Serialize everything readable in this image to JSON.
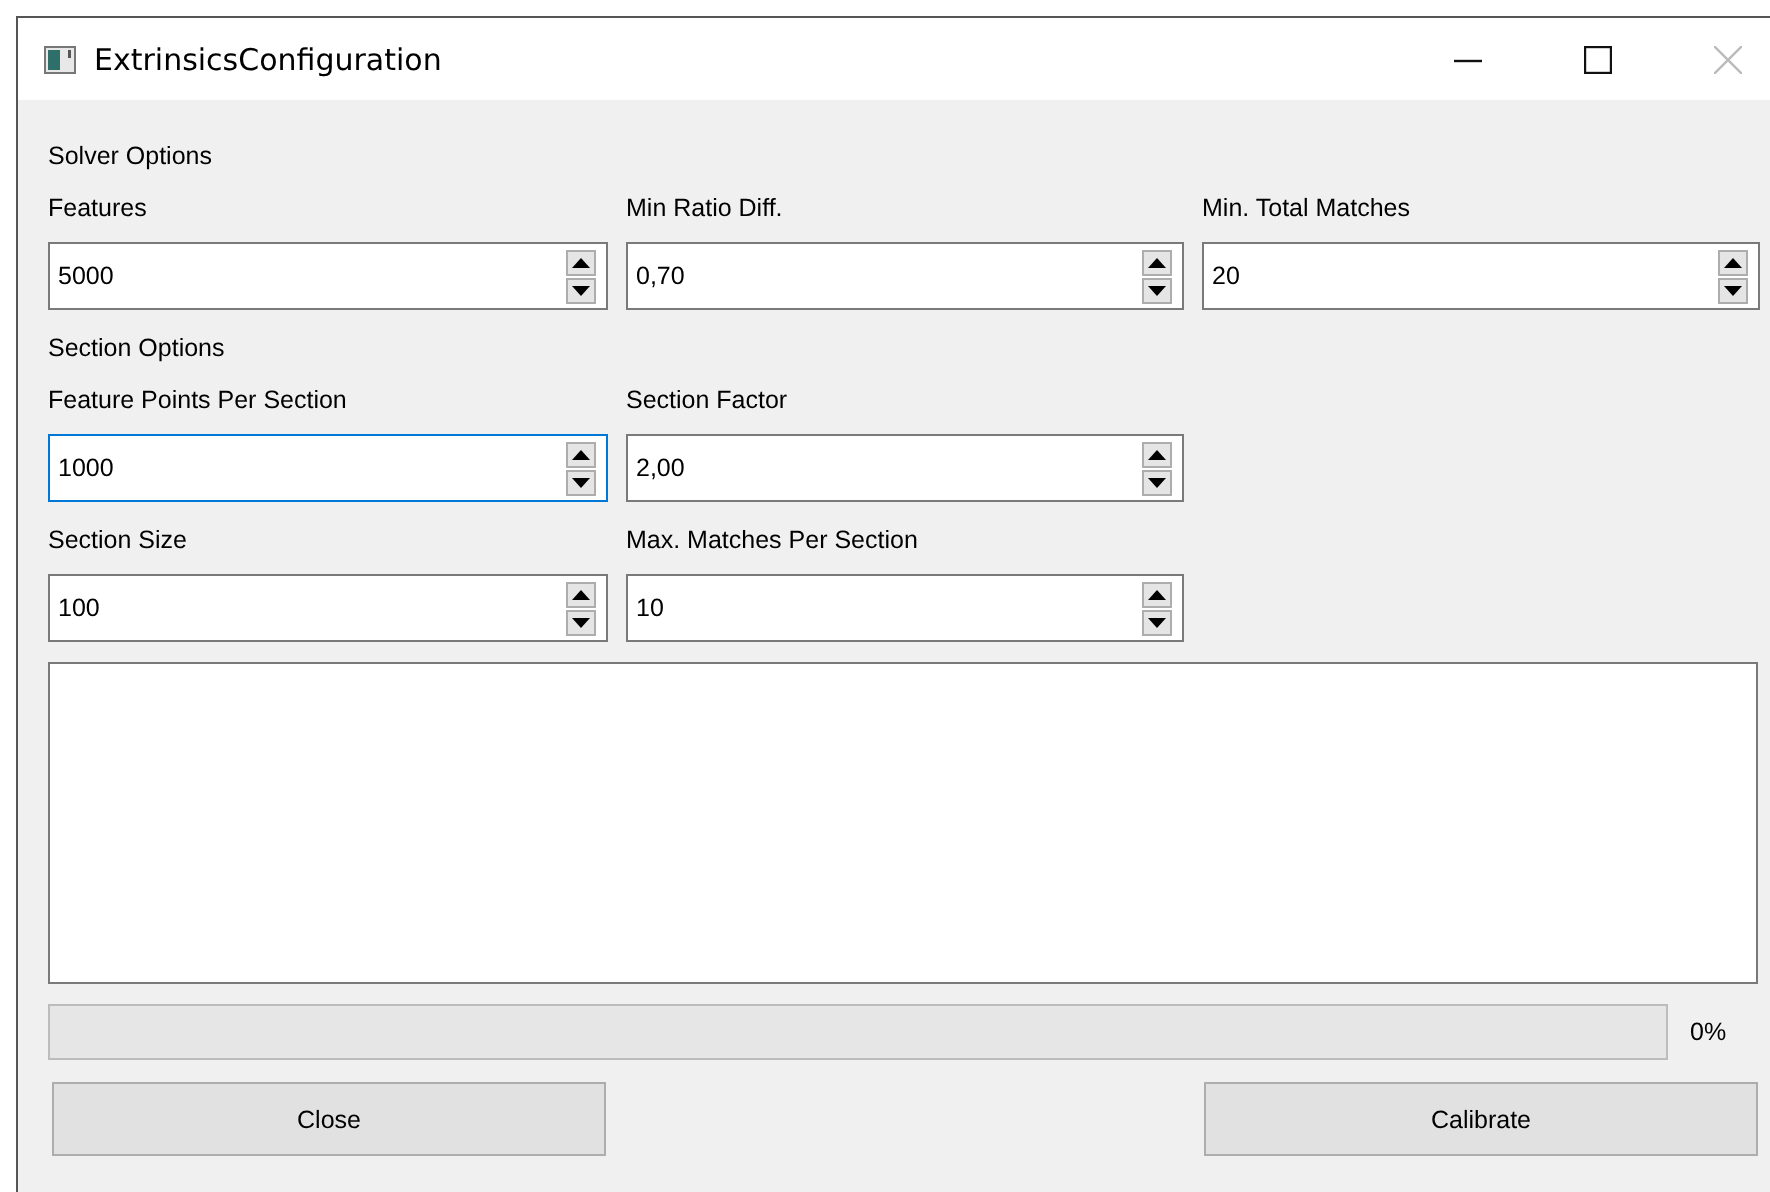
{
  "window": {
    "title": "ExtrinsicsConfiguration"
  },
  "solver_options": {
    "title": "Solver Options",
    "fields": [
      {
        "label": "Features",
        "value": "5000",
        "focused": false
      },
      {
        "label": "Min Ratio Diff.",
        "value": "0,70",
        "focused": false
      },
      {
        "label": "Min. Total Matches",
        "value": "20",
        "focused": false
      }
    ]
  },
  "section_options": {
    "title": "Section Options",
    "fields": [
      {
        "label": "Feature Points Per Section",
        "value": "1000",
        "focused": true
      },
      {
        "label": "Section Factor",
        "value": "2,00",
        "focused": false
      },
      {
        "label": "Section Size",
        "value": "100",
        "focused": false
      },
      {
        "label": "Max. Matches Per Section",
        "value": "10",
        "focused": false
      }
    ]
  },
  "progress": {
    "level": 0,
    "reading": "0%"
  },
  "buttons": [
    {
      "label": "Close"
    },
    {
      "label": "Calibrate"
    }
  ]
}
